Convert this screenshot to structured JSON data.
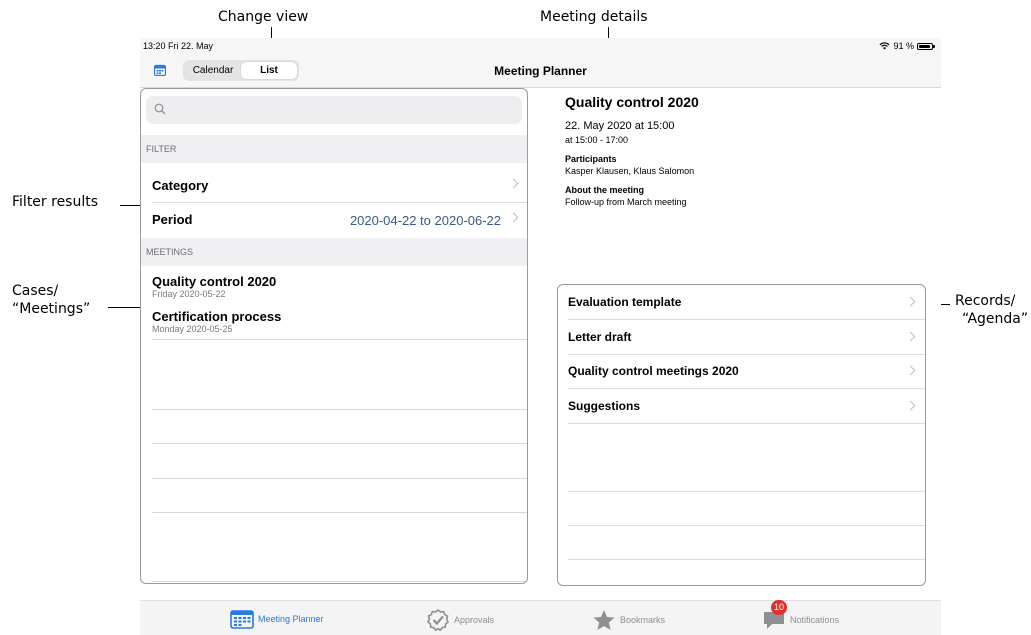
{
  "annotations": {
    "change_view": "Change view",
    "meeting_details": "Meeting details",
    "filter_results": "Filter results",
    "cases_line1": "Cases/",
    "cases_line2": "“Meetings”",
    "records_line1": "Records/",
    "records_line2": "“Agenda”"
  },
  "status_bar": {
    "time": "13:20  Fri 22. May",
    "battery": "91 %"
  },
  "navbar": {
    "calendar_icon": "calendar-icon",
    "segments": [
      {
        "label": "Calendar",
        "active": false
      },
      {
        "label": "List",
        "active": true
      }
    ],
    "title": "Meeting Planner"
  },
  "search": {
    "placeholder": "",
    "icon": "search-icon"
  },
  "filter": {
    "header": "FILTER",
    "category_label": "Category",
    "period_label": "Period",
    "period_value": "2020-04-22 to 2020-06-22"
  },
  "meetings": {
    "header": "MEETINGS",
    "items": [
      {
        "title": "Quality control 2020",
        "date": "Friday 2020-05-22"
      },
      {
        "title": "Certification process",
        "date": "Monday 2020-05-25"
      }
    ]
  },
  "details": {
    "title": "Quality control 2020",
    "date": "22. May 2020 at 15:00",
    "time": "at 15:00 - 17:00",
    "participants_label": "Participants",
    "participants": "Kasper Klausen, Klaus Salomon",
    "about_label": "About the meeting",
    "about": "Follow-up from March meeting"
  },
  "records": [
    {
      "label": "Evaluation template"
    },
    {
      "label": "Letter draft"
    },
    {
      "label": "Quality control meetings 2020"
    },
    {
      "label": "Suggestions"
    }
  ],
  "tabbar": {
    "tabs": [
      {
        "label": "Meeting Planner",
        "icon": "calendar-icon",
        "active": true
      },
      {
        "label": "Approvals",
        "icon": "approval-check-icon",
        "active": false
      },
      {
        "label": "Bookmarks",
        "icon": "star-icon",
        "active": false
      },
      {
        "label": "Notifications",
        "icon": "chat-bubble-icon",
        "active": false,
        "badge": "10"
      }
    ]
  },
  "colors": {
    "accent": "#2a7ae2",
    "period_value": "#3a5a8a",
    "badge": "#e0312a"
  }
}
